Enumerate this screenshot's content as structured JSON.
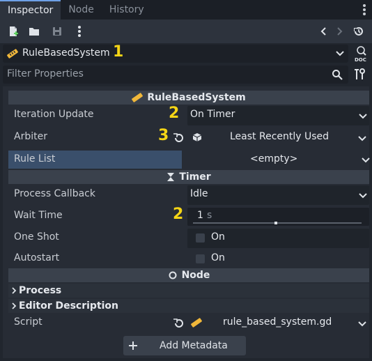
{
  "tabs": [
    {
      "label": "Inspector",
      "active": true
    },
    {
      "label": "Node",
      "active": false
    },
    {
      "label": "History",
      "active": false
    }
  ],
  "object_selector": {
    "name": "RuleBasedSystem",
    "badge": "1"
  },
  "filter": {
    "placeholder": "Filter Properties"
  },
  "sections": {
    "main": "RuleBasedSystem",
    "timer": "Timer",
    "node": "Node"
  },
  "properties": {
    "iteration_update": {
      "label": "Iteration Update",
      "value": "On Timer",
      "badge": "2"
    },
    "arbiter": {
      "label": "Arbiter",
      "value": "Least Recently Used",
      "badge": "3"
    },
    "rule_list": {
      "label": "Rule List",
      "value": "<empty>"
    },
    "process_callback": {
      "label": "Process Callback",
      "value": "Idle"
    },
    "wait_time": {
      "label": "Wait Time",
      "value": "1",
      "unit": "s",
      "badge": "2",
      "slider_fraction": 0.49
    },
    "one_shot": {
      "label": "One Shot",
      "value": "On"
    },
    "autostart": {
      "label": "Autostart",
      "value": "On"
    }
  },
  "groups": {
    "process": "Process",
    "editor_description": "Editor Description"
  },
  "script": {
    "label": "Script",
    "value": "rule_based_system.gd"
  },
  "add_metadata": {
    "label": "Add Metadata"
  },
  "colors": {
    "accent": "#6ea0e6",
    "badge": "#f5d516",
    "selected_row": "#3a4f6b"
  }
}
